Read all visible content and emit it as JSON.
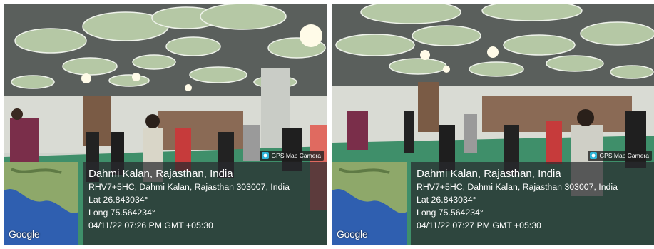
{
  "panels": [
    {
      "watermark": "GPS Map Camera",
      "map_label": "Google",
      "location_title": "Dahmi Kalan, Rajasthan, India",
      "address": "RHV7+5HC, Dahmi Kalan, Rajasthan 303007, India",
      "lat": "Lat 26.843034°",
      "long": "Long 75.564234°",
      "timestamp": "04/11/22 07:26 PM GMT +05:30"
    },
    {
      "watermark": "GPS Map Camera",
      "map_label": "Google",
      "location_title": "Dahmi Kalan, Rajasthan, India",
      "address": "RHV7+5HC, Dahmi Kalan, Rajasthan 303007, India",
      "lat": "Lat 26.843034°",
      "long": "Long 75.564234°",
      "timestamp": "04/11/22 07:27 PM GMT +05:30"
    }
  ],
  "colors": {
    "floor": "#3f8f6a",
    "ceiling": "#d8dcd4",
    "disc": "#a9c39a",
    "overlay_bg": "#2a2c2e",
    "map_sea": "#2f5fb0",
    "map_land": "#8ea86a"
  },
  "icons": [
    "camera-icon",
    "map-thumbnail"
  ]
}
